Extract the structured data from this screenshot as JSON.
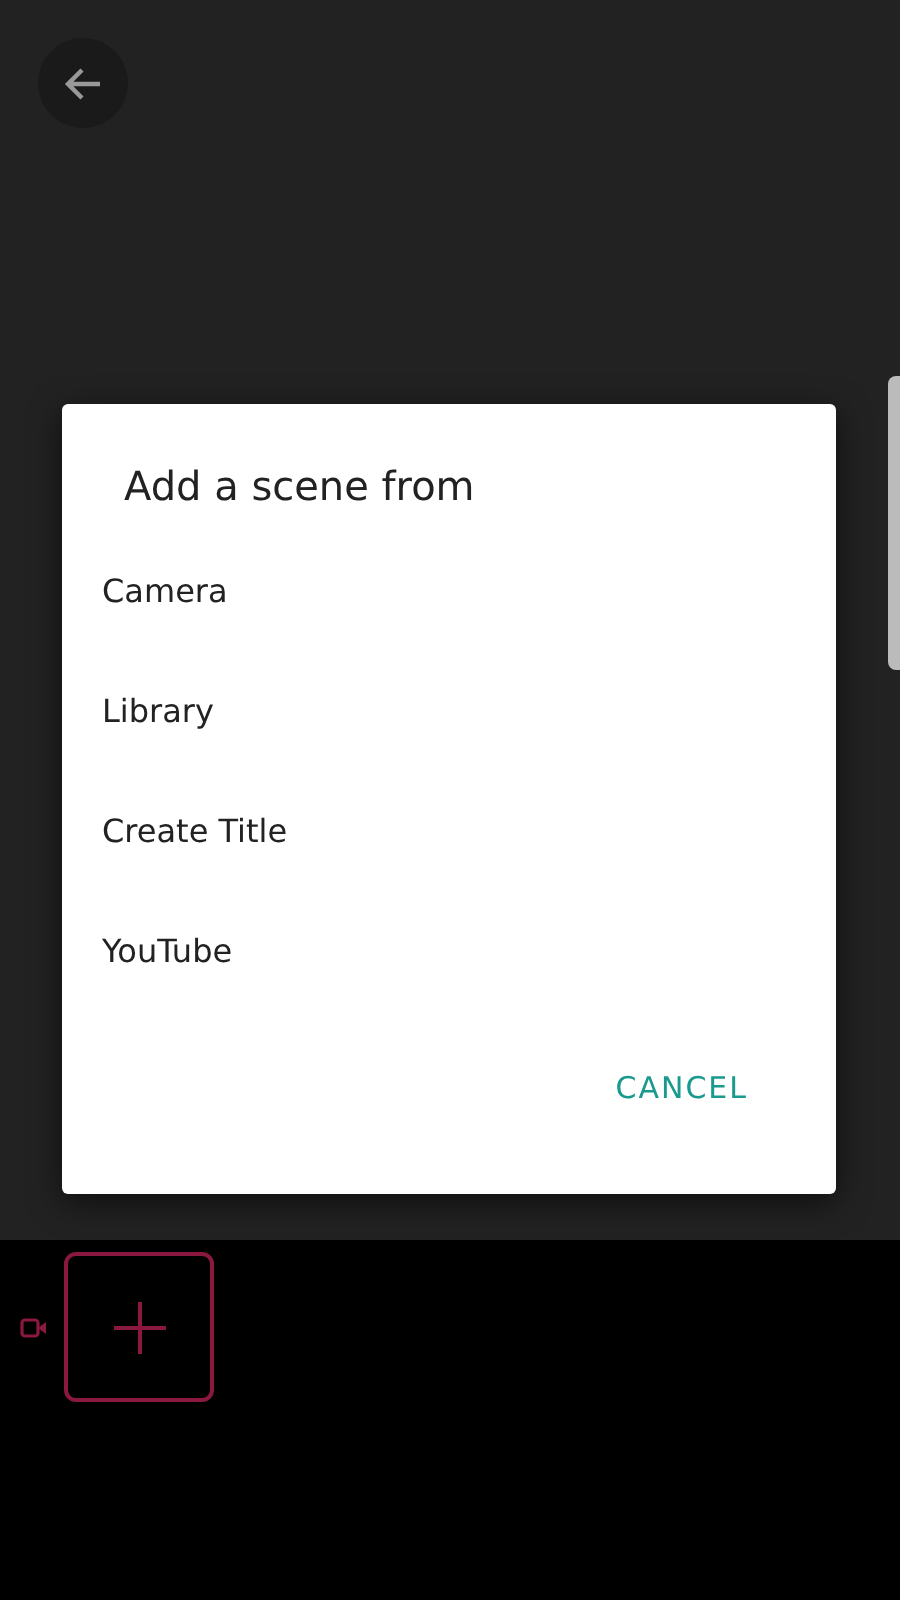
{
  "dialog": {
    "title": "Add a scene from",
    "options": [
      {
        "label": "Camera"
      },
      {
        "label": "Library"
      },
      {
        "label": "Create Title"
      },
      {
        "label": "YouTube"
      }
    ],
    "buttons": [
      "CANCEL"
    ]
  }
}
